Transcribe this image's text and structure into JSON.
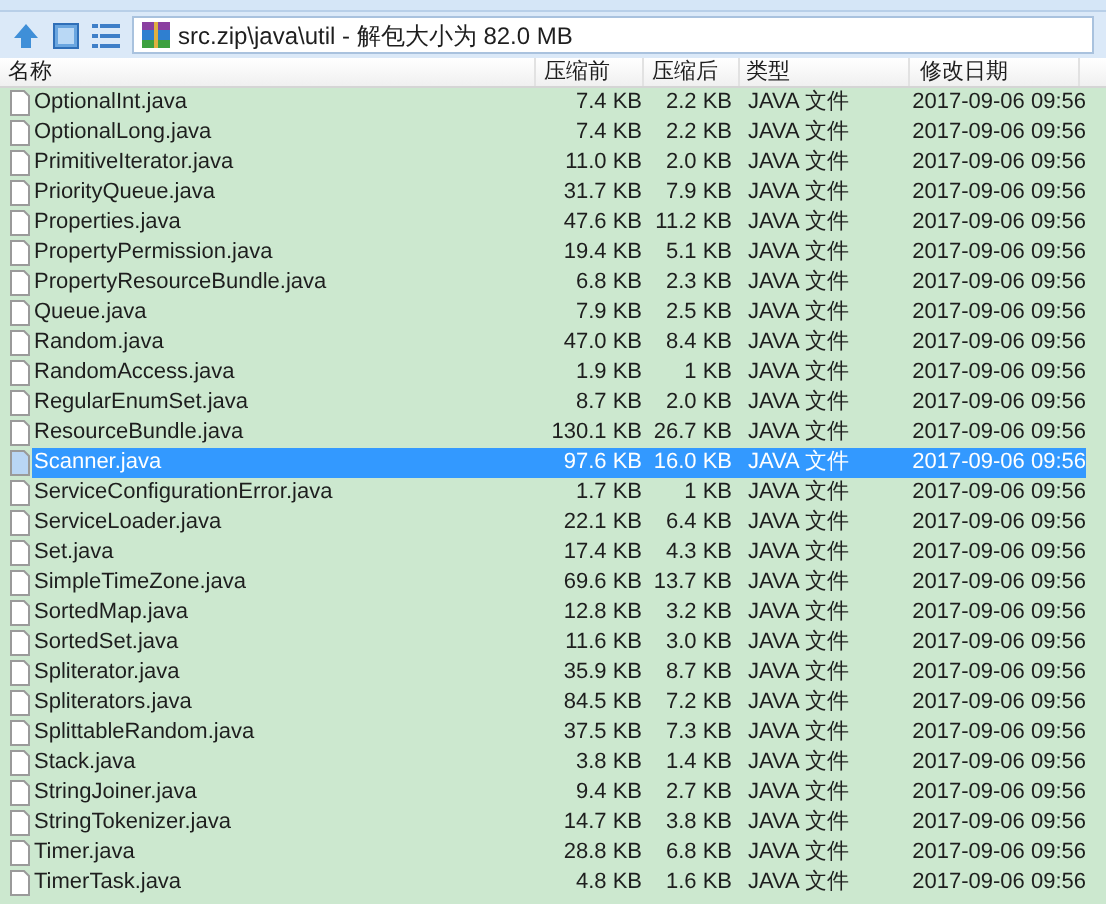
{
  "address": {
    "path": "src.zip\\java\\util - 解包大小为 82.0 MB"
  },
  "columns": [
    "名称",
    "压缩前",
    "压缩后",
    "类型",
    "修改日期"
  ],
  "rows": [
    {
      "name": "OptionalInt.java",
      "size": "7.4 KB",
      "packed": "2.2 KB",
      "type": "JAVA 文件",
      "modified": "2017-09-06 09:56",
      "selected": false
    },
    {
      "name": "OptionalLong.java",
      "size": "7.4 KB",
      "packed": "2.2 KB",
      "type": "JAVA 文件",
      "modified": "2017-09-06 09:56",
      "selected": false
    },
    {
      "name": "PrimitiveIterator.java",
      "size": "11.0 KB",
      "packed": "2.0 KB",
      "type": "JAVA 文件",
      "modified": "2017-09-06 09:56",
      "selected": false
    },
    {
      "name": "PriorityQueue.java",
      "size": "31.7 KB",
      "packed": "7.9 KB",
      "type": "JAVA 文件",
      "modified": "2017-09-06 09:56",
      "selected": false
    },
    {
      "name": "Properties.java",
      "size": "47.6 KB",
      "packed": "11.2 KB",
      "type": "JAVA 文件",
      "modified": "2017-09-06 09:56",
      "selected": false
    },
    {
      "name": "PropertyPermission.java",
      "size": "19.4 KB",
      "packed": "5.1 KB",
      "type": "JAVA 文件",
      "modified": "2017-09-06 09:56",
      "selected": false
    },
    {
      "name": "PropertyResourceBundle.java",
      "size": "6.8 KB",
      "packed": "2.3 KB",
      "type": "JAVA 文件",
      "modified": "2017-09-06 09:56",
      "selected": false
    },
    {
      "name": "Queue.java",
      "size": "7.9 KB",
      "packed": "2.5 KB",
      "type": "JAVA 文件",
      "modified": "2017-09-06 09:56",
      "selected": false
    },
    {
      "name": "Random.java",
      "size": "47.0 KB",
      "packed": "8.4 KB",
      "type": "JAVA 文件",
      "modified": "2017-09-06 09:56",
      "selected": false
    },
    {
      "name": "RandomAccess.java",
      "size": "1.9 KB",
      "packed": "1 KB",
      "type": "JAVA 文件",
      "modified": "2017-09-06 09:56",
      "selected": false
    },
    {
      "name": "RegularEnumSet.java",
      "size": "8.7 KB",
      "packed": "2.0 KB",
      "type": "JAVA 文件",
      "modified": "2017-09-06 09:56",
      "selected": false
    },
    {
      "name": "ResourceBundle.java",
      "size": "130.1 KB",
      "packed": "26.7 KB",
      "type": "JAVA 文件",
      "modified": "2017-09-06 09:56",
      "selected": false
    },
    {
      "name": "Scanner.java",
      "size": "97.6 KB",
      "packed": "16.0 KB",
      "type": "JAVA 文件",
      "modified": "2017-09-06 09:56",
      "selected": true
    },
    {
      "name": "ServiceConfigurationError.java",
      "size": "1.7 KB",
      "packed": "1 KB",
      "type": "JAVA 文件",
      "modified": "2017-09-06 09:56",
      "selected": false
    },
    {
      "name": "ServiceLoader.java",
      "size": "22.1 KB",
      "packed": "6.4 KB",
      "type": "JAVA 文件",
      "modified": "2017-09-06 09:56",
      "selected": false
    },
    {
      "name": "Set.java",
      "size": "17.4 KB",
      "packed": "4.3 KB",
      "type": "JAVA 文件",
      "modified": "2017-09-06 09:56",
      "selected": false
    },
    {
      "name": "SimpleTimeZone.java",
      "size": "69.6 KB",
      "packed": "13.7 KB",
      "type": "JAVA 文件",
      "modified": "2017-09-06 09:56",
      "selected": false
    },
    {
      "name": "SortedMap.java",
      "size": "12.8 KB",
      "packed": "3.2 KB",
      "type": "JAVA 文件",
      "modified": "2017-09-06 09:56",
      "selected": false
    },
    {
      "name": "SortedSet.java",
      "size": "11.6 KB",
      "packed": "3.0 KB",
      "type": "JAVA 文件",
      "modified": "2017-09-06 09:56",
      "selected": false
    },
    {
      "name": "Spliterator.java",
      "size": "35.9 KB",
      "packed": "8.7 KB",
      "type": "JAVA 文件",
      "modified": "2017-09-06 09:56",
      "selected": false
    },
    {
      "name": "Spliterators.java",
      "size": "84.5 KB",
      "packed": "7.2 KB",
      "type": "JAVA 文件",
      "modified": "2017-09-06 09:56",
      "selected": false
    },
    {
      "name": "SplittableRandom.java",
      "size": "37.5 KB",
      "packed": "7.3 KB",
      "type": "JAVA 文件",
      "modified": "2017-09-06 09:56",
      "selected": false
    },
    {
      "name": "Stack.java",
      "size": "3.8 KB",
      "packed": "1.4 KB",
      "type": "JAVA 文件",
      "modified": "2017-09-06 09:56",
      "selected": false
    },
    {
      "name": "StringJoiner.java",
      "size": "9.4 KB",
      "packed": "2.7 KB",
      "type": "JAVA 文件",
      "modified": "2017-09-06 09:56",
      "selected": false
    },
    {
      "name": "StringTokenizer.java",
      "size": "14.7 KB",
      "packed": "3.8 KB",
      "type": "JAVA 文件",
      "modified": "2017-09-06 09:56",
      "selected": false
    },
    {
      "name": "Timer.java",
      "size": "28.8 KB",
      "packed": "6.8 KB",
      "type": "JAVA 文件",
      "modified": "2017-09-06 09:56",
      "selected": false
    },
    {
      "name": "TimerTask.java",
      "size": "4.8 KB",
      "packed": "1.6 KB",
      "type": "JAVA 文件",
      "modified": "2017-09-06 09:56",
      "selected": false
    }
  ]
}
